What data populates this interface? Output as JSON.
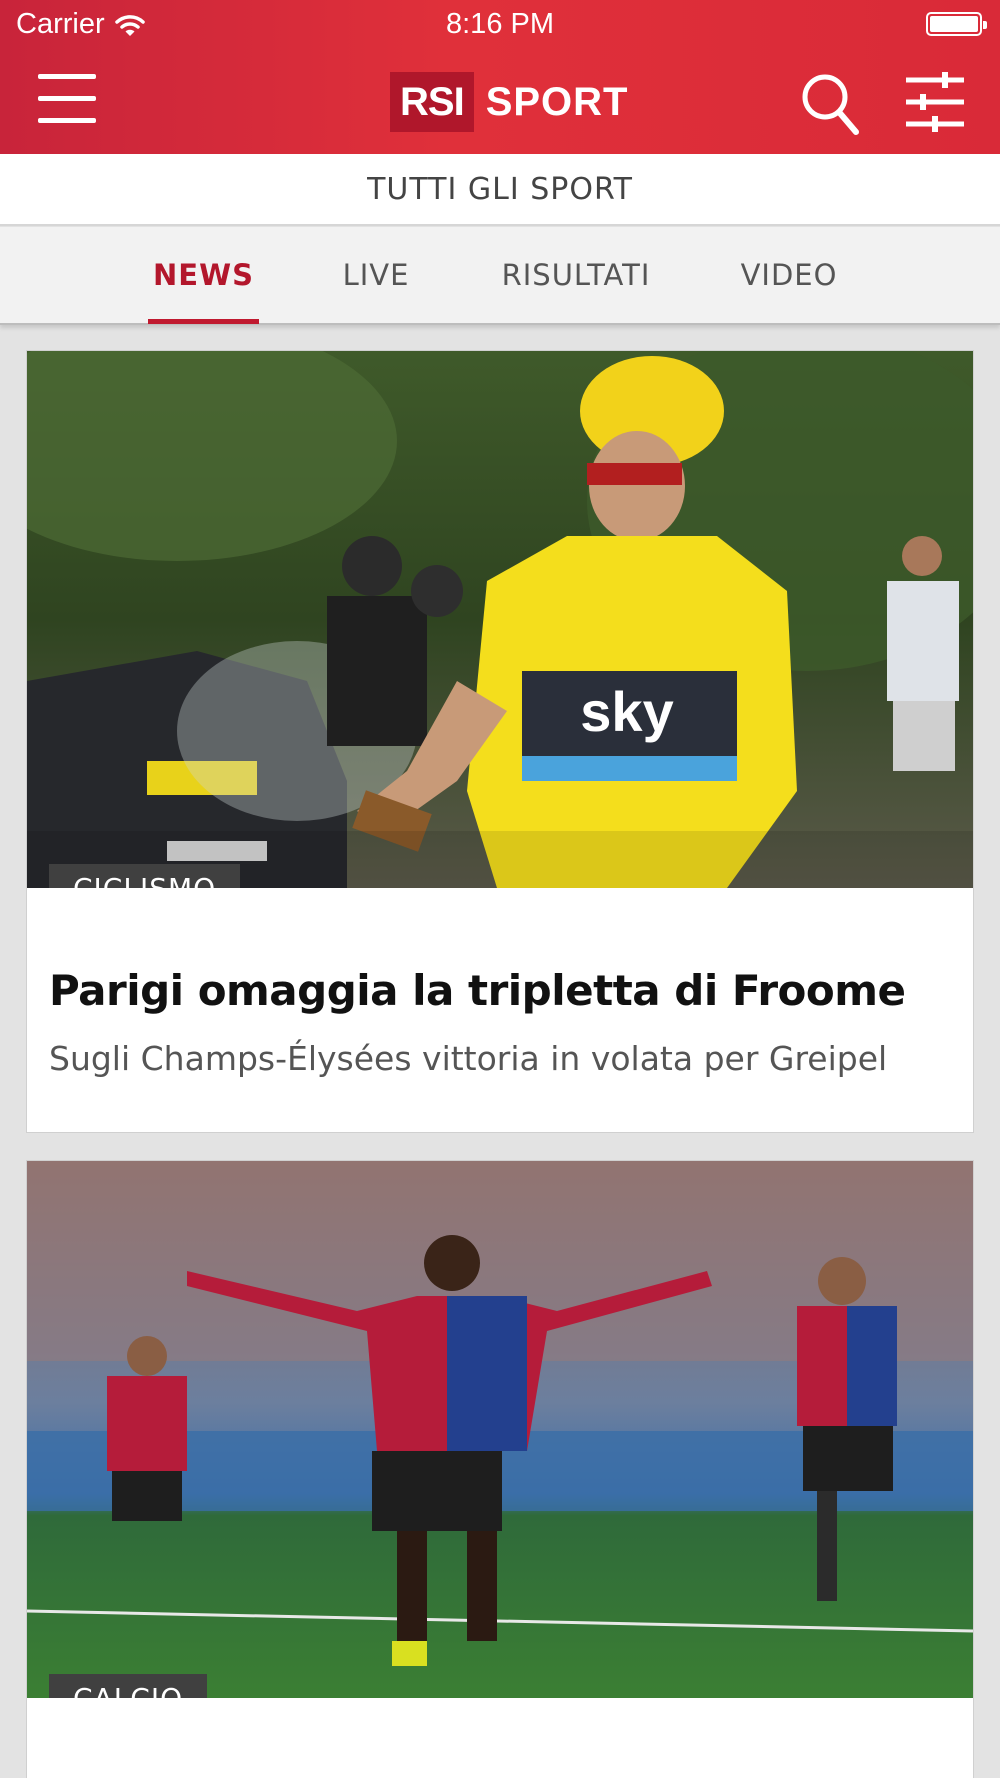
{
  "status_bar": {
    "carrier": "Carrier",
    "time": "8:16 PM"
  },
  "header": {
    "logo_box": "RSI",
    "logo_text": "SPORT",
    "brand_color": "#d92a38",
    "icons": [
      "menu-icon",
      "search-icon",
      "filter-icon"
    ]
  },
  "section": {
    "title": "TUTTI GLI SPORT"
  },
  "tabs": [
    {
      "label": "NEWS",
      "active": true
    },
    {
      "label": "LIVE",
      "active": false
    },
    {
      "label": "RISULTATI",
      "active": false
    },
    {
      "label": "VIDEO",
      "active": false
    }
  ],
  "accent_color": "#c0192f",
  "articles": [
    {
      "category": "CICLISMO",
      "title": "Parigi omaggia la tripletta di Froome",
      "subtitle": "Sugli Champs-Élysées vittoria in volata per Greipel"
    },
    {
      "category": "CALCIO",
      "title": "",
      "subtitle": ""
    }
  ]
}
